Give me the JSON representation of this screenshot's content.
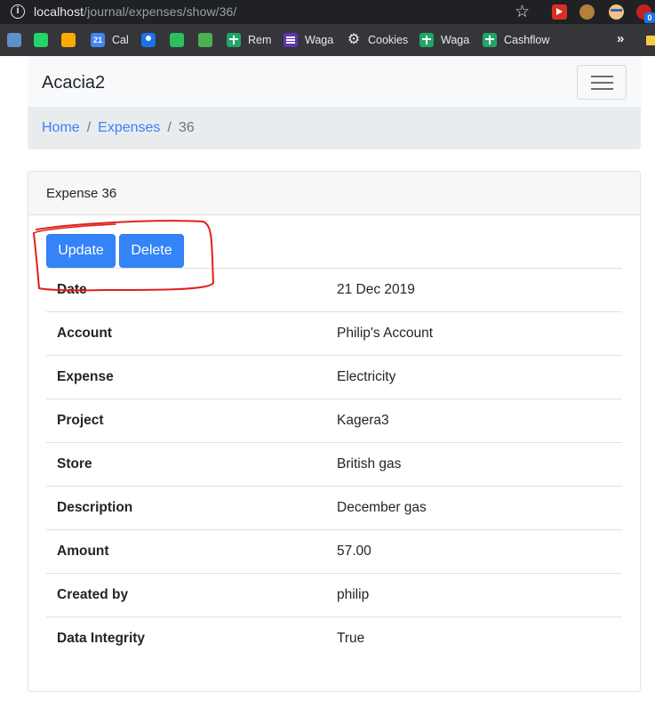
{
  "browser": {
    "url_host": "localhost",
    "url_path": "/journal/expenses/show/36/",
    "extension_badge": "0"
  },
  "bookmarks": [
    {
      "label": "",
      "icon": "dino-icon"
    },
    {
      "label": "",
      "icon": "whatsapp-icon"
    },
    {
      "label": "",
      "icon": "bulb-icon"
    },
    {
      "label": "Cal",
      "icon": "calendar-icon",
      "icon_text": "21"
    },
    {
      "label": "",
      "icon": "person-icon"
    },
    {
      "label": "",
      "icon": "evernote-icon"
    },
    {
      "label": "",
      "icon": "leaf-icon"
    },
    {
      "label": "Rem",
      "icon": "sheet-icon"
    },
    {
      "label": "Waga",
      "icon": "list-icon"
    },
    {
      "label": "Cookies",
      "icon": "gear-icon"
    },
    {
      "label": "Waga",
      "icon": "sheet-icon"
    },
    {
      "label": "Cashflow",
      "icon": "sheet-icon"
    }
  ],
  "navbar": {
    "brand": "Acacia2"
  },
  "breadcrumb": {
    "home": "Home",
    "expenses": "Expenses",
    "current": "36",
    "separator": "/"
  },
  "card": {
    "title": "Expense 36",
    "update_label": "Update",
    "delete_label": "Delete",
    "rows": [
      {
        "key": "Date",
        "value": "21 Dec 2019"
      },
      {
        "key": "Account",
        "value": "Philip's Account"
      },
      {
        "key": "Expense",
        "value": "Electricity"
      },
      {
        "key": "Project",
        "value": "Kagera3"
      },
      {
        "key": "Store",
        "value": "British gas"
      },
      {
        "key": "Description",
        "value": "December gas"
      },
      {
        "key": "Amount",
        "value": "57.00"
      },
      {
        "key": "Created by",
        "value": "philip"
      },
      {
        "key": "Data Integrity",
        "value": "True"
      }
    ]
  },
  "colors": {
    "primary": "#3483f7",
    "annotation": "#e0201c",
    "link": "#3b82f6"
  }
}
